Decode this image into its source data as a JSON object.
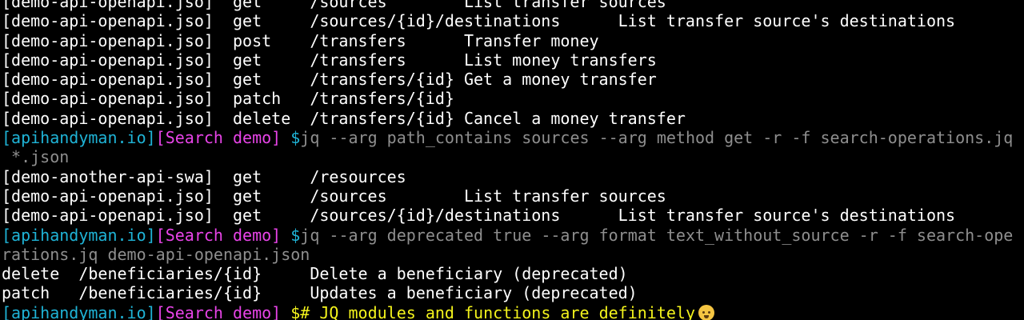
{
  "colors": {
    "background": "#000000",
    "output_text": "#ffffff",
    "prompt_host": "#1fb3d6",
    "prompt_dir": "#e844e8",
    "command_text": "#8e8e8e",
    "comment_text": "#f3f31c"
  },
  "lines": [
    {
      "type": "output",
      "text": "[demo-api-openapi.jso]  get     /sources        List transfer sources"
    },
    {
      "type": "output",
      "text": "[demo-api-openapi.jso]  get     /sources/{id}/destinations      List transfer source's destinations"
    },
    {
      "type": "output",
      "text": "[demo-api-openapi.jso]  post    /transfers      Transfer money"
    },
    {
      "type": "output",
      "text": "[demo-api-openapi.jso]  get     /transfers      List money transfers"
    },
    {
      "type": "output",
      "text": "[demo-api-openapi.jso]  get     /transfers/{id} Get a money transfer"
    },
    {
      "type": "output",
      "text": "[demo-api-openapi.jso]  patch   /transfers/{id}"
    },
    {
      "type": "output",
      "text": "[demo-api-openapi.jso]  delete  /transfers/{id} Cancel a money transfer"
    },
    {
      "type": "prompt",
      "host": "[apihandyman.io]",
      "dir": "[Search demo]",
      "symbol": " $",
      "command": "jq --arg path_contains sources --arg method get -r -f search-operations.jq"
    },
    {
      "type": "continuation",
      "text": " *.json"
    },
    {
      "type": "output",
      "text": "[demo-another-api-swa]  get     /resources"
    },
    {
      "type": "output",
      "text": "[demo-api-openapi.jso]  get     /sources        List transfer sources"
    },
    {
      "type": "output",
      "text": "[demo-api-openapi.jso]  get     /sources/{id}/destinations      List transfer source's destinations"
    },
    {
      "type": "prompt",
      "host": "[apihandyman.io]",
      "dir": "[Search demo]",
      "symbol": " $",
      "command": "jq --arg deprecated true --arg format text_without_source -r -f search-ope"
    },
    {
      "type": "continuation",
      "text": "rations.jq demo-api-openapi.json"
    },
    {
      "type": "output",
      "text": "delete  /beneficiaries/{id}     Delete a beneficiary (deprecated)"
    },
    {
      "type": "output",
      "text": "patch   /beneficiaries/{id}     Updates a beneficiary (deprecated)"
    },
    {
      "type": "comment-prompt",
      "host": "[apihandyman.io]",
      "dir": "[Search demo]",
      "symbol": " $",
      "command": "# JQ modules and functions are definitely",
      "icon": "exploding-head-emoji-icon"
    }
  ]
}
